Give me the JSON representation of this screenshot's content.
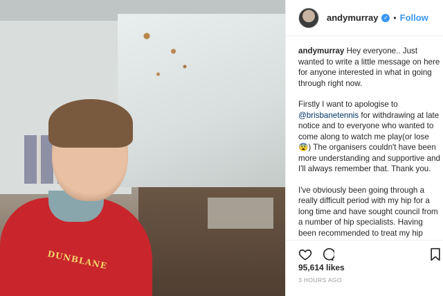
{
  "post": {
    "username": "andymurray",
    "verified_mark": "✓",
    "separator": "•",
    "follow_label": "Follow",
    "photo_shirt_text": "DUNBLANE"
  },
  "caption": {
    "p1_user": "andymurray",
    "p1_text": " Hey everyone.. Just wanted to write a little message on here for anyone interested in what in going through right now.",
    "p2_text_a": "Firstly I want to apologise to ",
    "p2_mention": "@brisbanetennis",
    "p2_text_b": " for withdrawing at late notice and to everyone who wanted to come along to watch me play(or lose😨) The organisers couldn't have been more understanding and supportive and I'll always remember that. Thank you.",
    "p3_text": "I've obviously been going through a really difficult period with my hip for a long time and have sought council from a number of hip specialists. Having been recommended to treat my hip conservatively since the US Open I have done everything asked of me from a rehab perspective and worked extremely hard to get back on the court"
  },
  "stats": {
    "likes": "95,614 likes",
    "time": "3 HOURS AGO"
  },
  "icons": [
    "heart-icon",
    "comment-icon",
    "bookmark-icon",
    "verified-badge-icon"
  ],
  "colors": {
    "link_blue": "#3897f0",
    "mention": "#003569",
    "text": "#262626",
    "muted": "#999999"
  }
}
